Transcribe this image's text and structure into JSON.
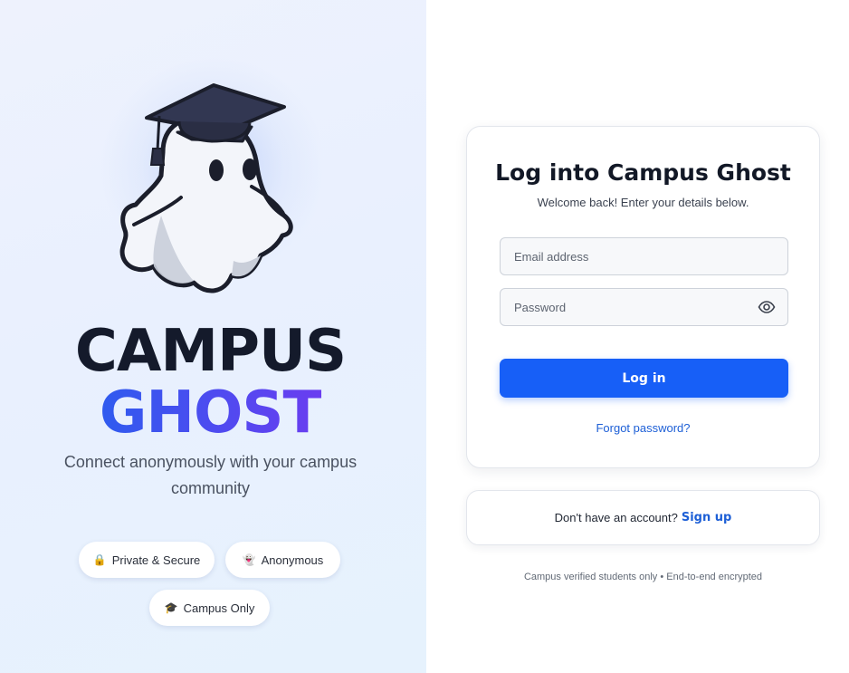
{
  "brand": {
    "line1": "CAMPUS",
    "line2": "GHOST",
    "tagline": "Connect anonymously with your campus community",
    "gradient_start": "#2f5bef",
    "gradient_end": "#6a3df0"
  },
  "mascot": {
    "icon": "graduate-ghost-icon"
  },
  "badges": [
    {
      "icon": "lock-icon",
      "glyph": "🔒",
      "label": "Private & Secure"
    },
    {
      "icon": "ghost-icon",
      "glyph": "👻",
      "label": "Anonymous"
    },
    {
      "icon": "graduation-cap-icon",
      "glyph": "🎓",
      "label": "Campus Only"
    }
  ],
  "login": {
    "title": "Log into Campus Ghost",
    "subtitle": "Welcome back! Enter your details below.",
    "email_placeholder": "Email address",
    "password_placeholder": "Password",
    "password_toggle_icon": "eye-icon",
    "submit_label": "Log in",
    "forgot_label": "Forgot password?",
    "accent_color": "#175ff7"
  },
  "signup": {
    "prompt": "Don't have an account?",
    "link_label": "Sign up"
  },
  "footer": {
    "note": "Campus verified students only • End-to-end encrypted"
  }
}
